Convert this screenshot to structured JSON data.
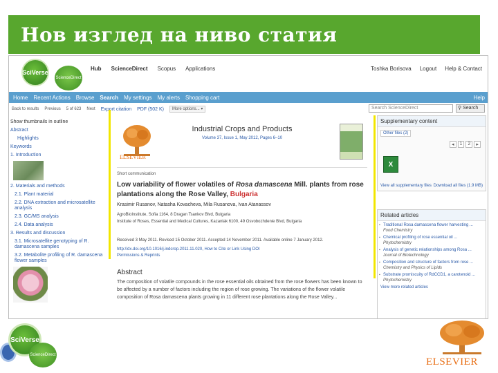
{
  "slide": {
    "title": "Нов изглед на ниво статия"
  },
  "logos": {
    "sciverse": "SciVerse",
    "sciencedirect": "ScienceDirect",
    "elsevier": "ELSEVIER"
  },
  "top_links": [
    "Hub",
    "ScienceDirect",
    "Scopus",
    "Applications"
  ],
  "user_links": [
    "Toshka Borisova",
    "Logout",
    "Help & Contact"
  ],
  "nav": {
    "items": [
      "Home",
      "Recent Actions",
      "Browse",
      "Search",
      "My settings",
      "My alerts",
      "Shopping cart"
    ],
    "help": "Help"
  },
  "toolbar": {
    "items": [
      "Back to results",
      "Previous",
      "5 of 623",
      "Next"
    ],
    "export": "Export citation",
    "pdf": "PDF (502 K)",
    "more": "More options..."
  },
  "search": {
    "placeholder": "Search ScienceDirect",
    "button": "Search"
  },
  "outline": {
    "items": [
      "Show thumbnails in outline",
      "Abstract",
      "Highlights",
      "Keywords",
      "1. Introduction",
      "2. Materials and methods",
      "2.1. Plant material",
      "2.2. DNA extraction and microsatellite analysis",
      "2.3. GC/MS analysis",
      "2.4. Data analysis",
      "3. Results and discussion",
      "3.1. Microsatellite genotyping of R. damascena samples",
      "3.2. Metabolite profiling of R. damascena flower samples"
    ]
  },
  "article": {
    "journal": "Industrial Crops and Products",
    "volume": "Volume 37, Issue 1, May 2012, Pages 6–10",
    "type": "Short communication",
    "title_a": "Low variability of flower volatiles of ",
    "title_species": "Rosa damascena",
    "title_b": " Mill. plants from rose plantations along the Rose Valley, ",
    "title_place": "Bulgaria",
    "authors": "Krasimir Rusanov, Natasha Kovacheva, Mila Rusanova, Ivan Atanassov",
    "affil_a": "AgroBioInstitute, Sofia 1164, 8 Dragan Tsankov Blvd, Bulgaria",
    "affil_b": "Institute of Roses, Essential and Medical Cultures, Kazanlak 6100, 49 Osvobozhdenie Blvd, Bulgaria",
    "history": "Received 3 May 2011. Revised 15 October 2011. Accepted 14 November 2011. Available online 7 January 2012.",
    "doi": "http://dx.doi.org/10.1016/j.indcrop.2011.11.020, How to Cite or Link Using DOI",
    "permissions": "Permissions & Reprints",
    "abstract_title": "Abstract",
    "abstract_text": "The composition of volatile compounds in the rose essential oils obtained from the rose flowers has been known to be affected by a number of factors including the region of rose growing. The variations of the flower volatile composition of Rosa damascena plants growing in 11 different rose plantations along the Rose Valley..."
  },
  "supplementary": {
    "title": "Supplementary content",
    "tab": "Other files (2)",
    "pager": [
      "1",
      "2"
    ],
    "view_all": "View all supplementary files",
    "download": "Download all files (1.9 MB)"
  },
  "related": {
    "title": "Related articles",
    "items": [
      {
        "title": "Traditional Rosa damascena flower harvesting ...",
        "source": "Food Chemistry"
      },
      {
        "title": "Chemical profiling of rose essential oil ...",
        "source": "Phytochemistry"
      },
      {
        "title": "Analysis of genetic relationships among Rosa ...",
        "source": "Journal of Biotechnology"
      },
      {
        "title": "Composition and structure of factors from rose ...",
        "source": "Chemistry and Physics of Lipids"
      },
      {
        "title": "Substrate promiscuity of RdCCD1, a carotenoid ...",
        "source": "Phytochemistry"
      }
    ],
    "view_more": "View more related articles"
  },
  "colors": {
    "title_bar": "#58a72e",
    "nav": "#5a9fce",
    "link": "#2a5aa8",
    "elsevier_orange": "#e86e14",
    "guide_yellow": "#f2e600"
  }
}
